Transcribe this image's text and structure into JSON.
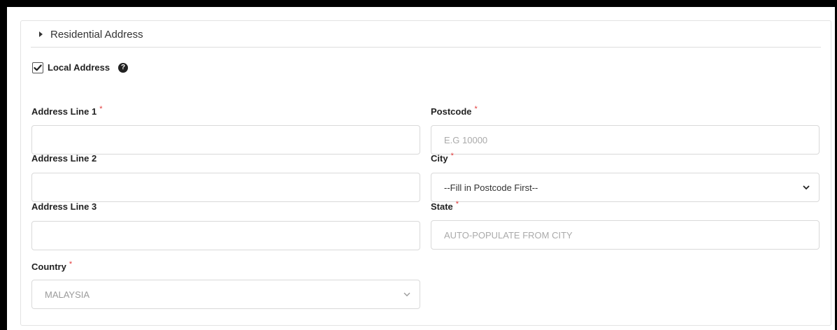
{
  "section": {
    "title": "Residential Address"
  },
  "local_address": {
    "label": "Local Address",
    "checked": true,
    "help_icon": "question-circle-icon"
  },
  "fields": {
    "address1": {
      "label": "Address Line 1",
      "required_marker": "*",
      "value": ""
    },
    "address2": {
      "label": "Address Line 2",
      "value": ""
    },
    "address3": {
      "label": "Address Line 3",
      "value": ""
    },
    "country": {
      "label": "Country",
      "required_marker": "*",
      "selected": "MALAYSIA"
    },
    "postcode": {
      "label": "Postcode",
      "required_marker": "*",
      "placeholder": "E.G 10000"
    },
    "city": {
      "label": "City",
      "required_marker": "*",
      "selected": "--Fill in Postcode First--"
    },
    "state": {
      "label": "State",
      "required_marker": "*",
      "placeholder": "AUTO-POPULATE FROM CITY"
    }
  },
  "colors": {
    "required": "#e23a3a",
    "border": "#d9d9d9",
    "placeholder": "#aaaaaa"
  }
}
